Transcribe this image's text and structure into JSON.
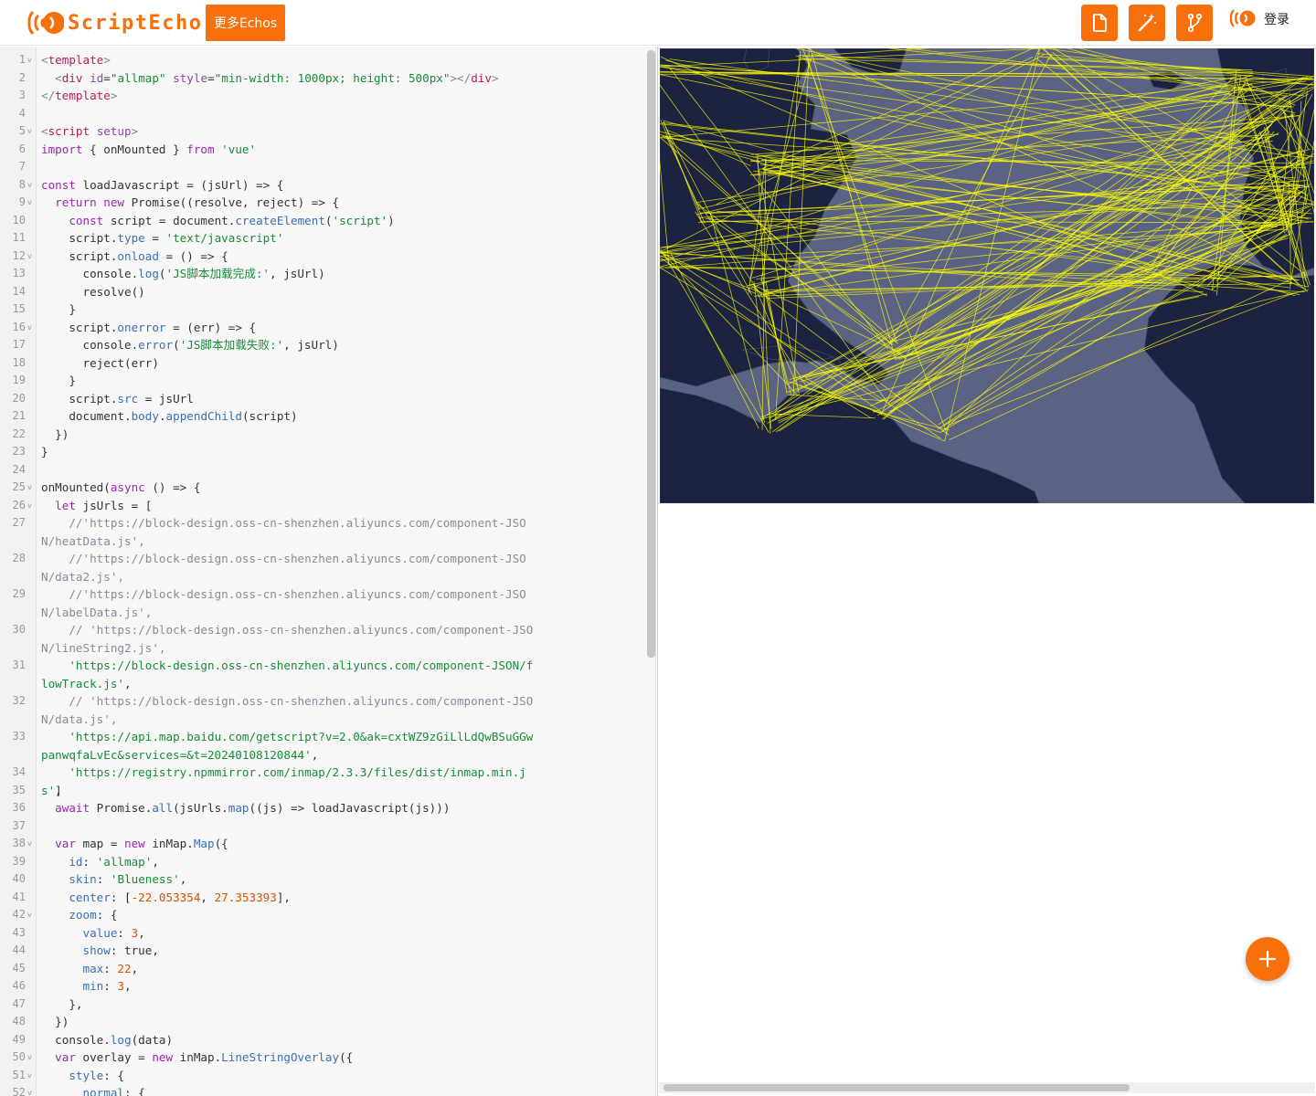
{
  "header": {
    "logo_text": "ScriptEcho",
    "more_button": "更多Echos",
    "login": "登录",
    "icons": [
      "document-icon",
      "magic-wand-icon",
      "branch-icon"
    ]
  },
  "colors": {
    "accent": "#f7700b",
    "map_sea": "#5a6383",
    "map_land": "#1b2340",
    "flow_line": "#ffff00"
  },
  "editor": {
    "lines": [
      {
        "n": "1",
        "fold": true,
        "html": "<span style='color:#888'>&lt;</span><span style='color:#c2185b'>template</span><span style='color:#888'>&gt;</span>"
      },
      {
        "n": "2",
        "html": "  <span style='color:#888'>&lt;</span><span style='color:#c2185b'>div</span> <span style='color:#8e44ad'>id</span>=<span style='color:#1a8a3a'>\"allmap\"</span> <span style='color:#8e44ad'>style</span>=<span style='color:#1a8a3a'>\"min-width: 1000px; height: 500px\"</span><span style='color:#888'>&gt;&lt;/</span><span style='color:#c2185b'>div</span><span style='color:#888'>&gt;</span>"
      },
      {
        "n": "3",
        "html": "<span style='color:#888'>&lt;/</span><span style='color:#c2185b'>template</span><span style='color:#888'>&gt;</span>"
      },
      {
        "n": "4",
        "html": ""
      },
      {
        "n": "5",
        "fold": true,
        "html": "<span style='color:#888'>&lt;</span><span style='color:#c2185b'>script</span> <span style='color:#8e44ad'>setup</span><span style='color:#888'>&gt;</span>"
      },
      {
        "n": "6",
        "html": "<span style='color:#9c27b0'>import</span> { onMounted } <span style='color:#9c27b0'>from</span> <span style='color:#1a8a3a'>'vue'</span>"
      },
      {
        "n": "7",
        "html": ""
      },
      {
        "n": "8",
        "fold": true,
        "html": "<span style='color:#9c27b0'>const</span> loadJavascript = (jsUrl) =&gt; {"
      },
      {
        "n": "9",
        "fold": true,
        "html": "  <span style='color:#9c27b0'>return</span> <span style='color:#9c27b0'>new</span> Promise((resolve, reject) =&gt; {"
      },
      {
        "n": "10",
        "html": "    <span style='color:#9c27b0'>const</span> script = document.<span style='color:#3a6fb0'>createElement</span>(<span style='color:#1a8a3a'>'script'</span>)"
      },
      {
        "n": "11",
        "html": "    script.<span style='color:#3a6fb0'>type</span> = <span style='color:#1a8a3a'>'text/javascript'</span>"
      },
      {
        "n": "12",
        "fold": true,
        "html": "    script.<span style='color:#3a6fb0'>onload</span> = () =&gt; {"
      },
      {
        "n": "13",
        "html": "      console.<span style='color:#3a6fb0'>log</span>(<span style='color:#1a8a3a'>'JS脚本加载完成:'</span>, jsUrl)"
      },
      {
        "n": "14",
        "html": "      resolve()"
      },
      {
        "n": "15",
        "html": "    }"
      },
      {
        "n": "16",
        "fold": true,
        "html": "    script.<span style='color:#3a6fb0'>onerror</span> = (err) =&gt; {"
      },
      {
        "n": "17",
        "html": "      console.<span style='color:#3a6fb0'>error</span>(<span style='color:#1a8a3a'>'JS脚本加载失败:'</span>, jsUrl)"
      },
      {
        "n": "18",
        "html": "      reject(err)"
      },
      {
        "n": "19",
        "html": "    }"
      },
      {
        "n": "20",
        "html": "    script.<span style='color:#3a6fb0'>src</span> = jsUrl"
      },
      {
        "n": "21",
        "html": "    document.<span style='color:#3a6fb0'>body</span>.<span style='color:#3a6fb0'>appendChild</span>(script)"
      },
      {
        "n": "22",
        "html": "  })"
      },
      {
        "n": "23",
        "html": "}"
      },
      {
        "n": "24",
        "html": ""
      },
      {
        "n": "25",
        "fold": true,
        "html": "onMounted(<span style='color:#9c27b0'>async</span> () =&gt; {"
      },
      {
        "n": "26",
        "fold": true,
        "html": "  <span style='color:#9c27b0'>let</span> jsUrls = ["
      },
      {
        "n": "27",
        "wrap": true,
        "html": "    <span style='color:#8a8a9a'>//'https://block-design.oss-cn-shenzhen.aliyuncs.com/component-JSON/heatData.js',</span>"
      },
      {
        "n": "28",
        "wrap": true,
        "html": "    <span style='color:#8a8a9a'>//'https://block-design.oss-cn-shenzhen.aliyuncs.com/component-JSON/data2.js',</span>"
      },
      {
        "n": "29",
        "wrap": true,
        "html": "    <span style='color:#8a8a9a'>//'https://block-design.oss-cn-shenzhen.aliyuncs.com/component-JSON/labelData.js',</span>"
      },
      {
        "n": "30",
        "wrap": true,
        "html": "    <span style='color:#8a8a9a'>// 'https://block-design.oss-cn-shenzhen.aliyuncs.com/component-JSON/lineString2.js',</span>"
      },
      {
        "n": "31",
        "wrap": true,
        "html": "    <span style='color:#1a8a3a'>'https://block-design.oss-cn-shenzhen.aliyuncs.com/component-JSON/flowTrack.js'</span>,"
      },
      {
        "n": "32",
        "wrap": true,
        "html": "    <span style='color:#8a8a9a'>// 'https://block-design.oss-cn-shenzhen.aliyuncs.com/component-JSON/data.js',</span>"
      },
      {
        "n": "33",
        "wrap": true,
        "html": "    <span style='color:#1a8a3a'>'https://api.map.baidu.com/getscript?v=2.0&amp;ak=cxtWZ9zGiLlLdQwBSuGGwpanwqfaLvEc&amp;services=&amp;t=20240108120844'</span>,"
      },
      {
        "n": "34",
        "html": "    <span style='color:#1a8a3a'>'https://registry.npmmirror.com/inmap/2.3.3/files/dist/inmap.min.js'</span>,"
      },
      {
        "n": "35",
        "html": "  ]"
      },
      {
        "n": "36",
        "html": "  <span style='color:#9c27b0'>await</span> Promise.<span style='color:#3a6fb0'>all</span>(jsUrls.<span style='color:#3a6fb0'>map</span>((js) =&gt; loadJavascript(js)))"
      },
      {
        "n": "37",
        "html": ""
      },
      {
        "n": "38",
        "fold": true,
        "html": "  <span style='color:#9c27b0'>var</span> map = <span style='color:#9c27b0'>new</span> inMap.<span style='color:#3a6fb0'>Map</span>({"
      },
      {
        "n": "39",
        "html": "    <span style='color:#3a6fb0'>id</span>: <span style='color:#1a8a3a'>'allmap'</span>,"
      },
      {
        "n": "40",
        "html": "    <span style='color:#3a6fb0'>skin</span>: <span style='color:#1a8a3a'>'Blueness'</span>,"
      },
      {
        "n": "41",
        "html": "    <span style='color:#3a6fb0'>center</span>: [<span style='color:#d35400'>-22.053354</span>, <span style='color:#d35400'>27.353393</span>],"
      },
      {
        "n": "42",
        "fold": true,
        "html": "    <span style='color:#3a6fb0'>zoom</span>: {"
      },
      {
        "n": "43",
        "html": "      <span style='color:#3a6fb0'>value</span>: <span style='color:#d35400'>3</span>,"
      },
      {
        "n": "44",
        "html": "      <span style='color:#3a6fb0'>show</span>: true,"
      },
      {
        "n": "45",
        "html": "      <span style='color:#3a6fb0'>max</span>: <span style='color:#d35400'>22</span>,"
      },
      {
        "n": "46",
        "html": "      <span style='color:#3a6fb0'>min</span>: <span style='color:#d35400'>3</span>,"
      },
      {
        "n": "47",
        "html": "    },"
      },
      {
        "n": "48",
        "html": "  })"
      },
      {
        "n": "49",
        "html": "  console.<span style='color:#3a6fb0'>log</span>(data)"
      },
      {
        "n": "50",
        "fold": true,
        "html": "  <span style='color:#9c27b0'>var</span> overlay = <span style='color:#9c27b0'>new</span> inMap.<span style='color:#3a6fb0'>LineStringOverlay</span>({"
      },
      {
        "n": "51",
        "fold": true,
        "html": "    <span style='color:#3a6fb0'>style</span>: {"
      },
      {
        "n": "52",
        "fold": true,
        "html": "      <span style='color:#3a6fb0'>normal</span>: {"
      }
    ]
  }
}
